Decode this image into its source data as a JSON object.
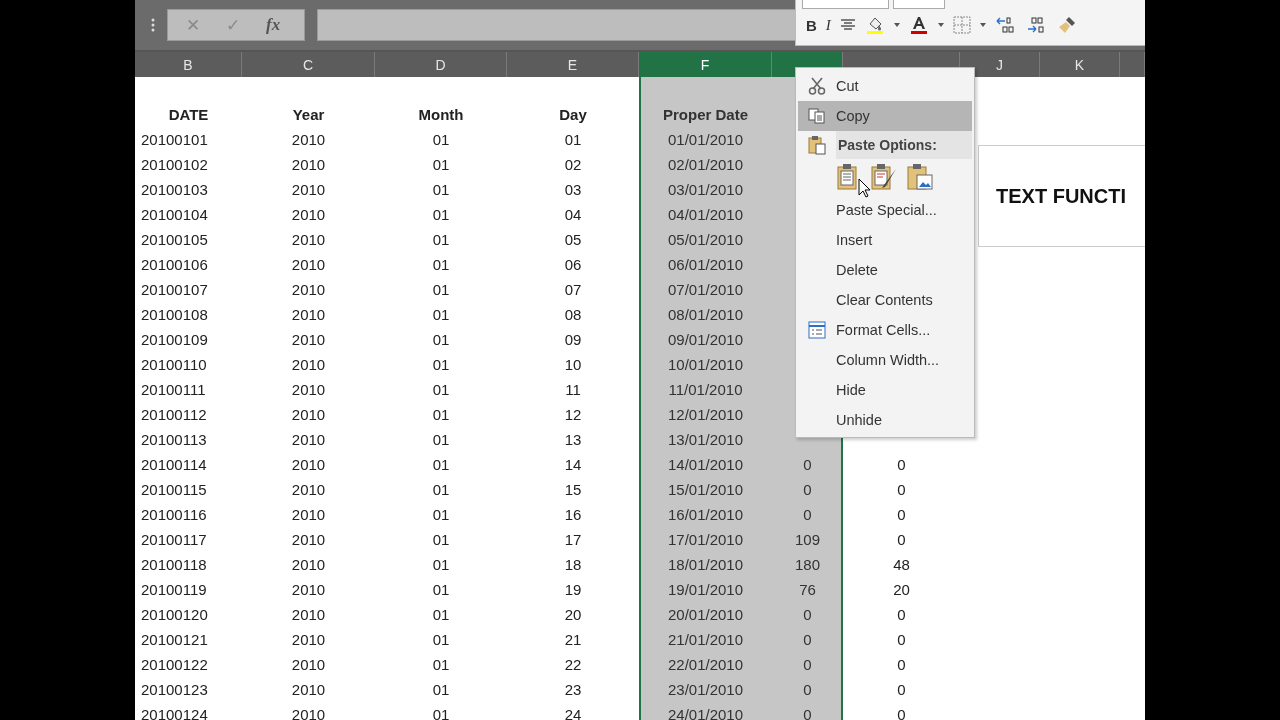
{
  "formula_bar": {
    "cancel": "✕",
    "enter": "✓",
    "function": "fx"
  },
  "columns": [
    {
      "label": "B",
      "selected": false
    },
    {
      "label": "C",
      "selected": false
    },
    {
      "label": "D",
      "selected": false
    },
    {
      "label": "E",
      "selected": false
    },
    {
      "label": "F",
      "selected": true
    },
    {
      "selected": true
    },
    {
      "selected": false
    },
    {
      "label": "J",
      "selected": false
    },
    {
      "label": "K",
      "selected": false
    }
  ],
  "headers": [
    "DATE",
    "Year",
    "Month",
    "Day",
    "Proper Date"
  ],
  "rows": [
    {
      "date": "20100101",
      "year": "2010",
      "month": "01",
      "day": "01",
      "proper_date": "01/01/2010"
    },
    {
      "date": "20100102",
      "year": "2010",
      "month": "01",
      "day": "02",
      "proper_date": "02/01/2010"
    },
    {
      "date": "20100103",
      "year": "2010",
      "month": "01",
      "day": "03",
      "proper_date": "03/01/2010"
    },
    {
      "date": "20100104",
      "year": "2010",
      "month": "01",
      "day": "04",
      "proper_date": "04/01/2010"
    },
    {
      "date": "20100105",
      "year": "2010",
      "month": "01",
      "day": "05",
      "proper_date": "05/01/2010"
    },
    {
      "date": "20100106",
      "year": "2010",
      "month": "01",
      "day": "06",
      "proper_date": "06/01/2010"
    },
    {
      "date": "20100107",
      "year": "2010",
      "month": "01",
      "day": "07",
      "proper_date": "07/01/2010"
    },
    {
      "date": "20100108",
      "year": "2010",
      "month": "01",
      "day": "08",
      "proper_date": "08/01/2010"
    },
    {
      "date": "20100109",
      "year": "2010",
      "month": "01",
      "day": "09",
      "proper_date": "09/01/2010"
    },
    {
      "date": "20100110",
      "year": "2010",
      "month": "01",
      "day": "10",
      "proper_date": "10/01/2010"
    },
    {
      "date": "20100111",
      "year": "2010",
      "month": "01",
      "day": "11",
      "proper_date": "11/01/2010"
    },
    {
      "date": "20100112",
      "year": "2010",
      "month": "01",
      "day": "12",
      "proper_date": "12/01/2010"
    },
    {
      "date": "20100113",
      "year": "2010",
      "month": "01",
      "day": "13",
      "proper_date": "13/01/2010"
    },
    {
      "date": "20100114",
      "year": "2010",
      "month": "01",
      "day": "14",
      "proper_date": "14/01/2010",
      "col_h": "0",
      "col_i": "0"
    },
    {
      "date": "20100115",
      "year": "2010",
      "month": "01",
      "day": "15",
      "proper_date": "15/01/2010",
      "col_h": "0",
      "col_i": "0"
    },
    {
      "date": "20100116",
      "year": "2010",
      "month": "01",
      "day": "16",
      "proper_date": "16/01/2010",
      "col_h": "0",
      "col_i": "0"
    },
    {
      "date": "20100117",
      "year": "2010",
      "month": "01",
      "day": "17",
      "proper_date": "17/01/2010",
      "col_h": "109",
      "col_i": "0"
    },
    {
      "date": "20100118",
      "year": "2010",
      "month": "01",
      "day": "18",
      "proper_date": "18/01/2010",
      "col_h": "180",
      "col_i": "48"
    },
    {
      "date": "20100119",
      "year": "2010",
      "month": "01",
      "day": "19",
      "proper_date": "19/01/2010",
      "col_h": "76",
      "col_i": "20"
    },
    {
      "date": "20100120",
      "year": "2010",
      "month": "01",
      "day": "20",
      "proper_date": "20/01/2010",
      "col_h": "0",
      "col_i": "0"
    },
    {
      "date": "20100121",
      "year": "2010",
      "month": "01",
      "day": "21",
      "proper_date": "21/01/2010",
      "col_h": "0",
      "col_i": "0"
    },
    {
      "date": "20100122",
      "year": "2010",
      "month": "01",
      "day": "22",
      "proper_date": "22/01/2010",
      "col_h": "0",
      "col_i": "0"
    },
    {
      "date": "20100123",
      "year": "2010",
      "month": "01",
      "day": "23",
      "proper_date": "23/01/2010",
      "col_h": "0",
      "col_i": "0"
    },
    {
      "date": "20100124",
      "year": "2010",
      "month": "01",
      "day": "24",
      "proper_date": "24/01/2010",
      "col_h": "0",
      "col_i": "0"
    }
  ],
  "mini_toolbar": {
    "bold": "B",
    "italic": "I"
  },
  "context_menu": {
    "items": [
      {
        "kind": "command",
        "label": "Cut",
        "selected": false
      },
      {
        "kind": "command",
        "label": "Copy",
        "selected": true
      },
      {
        "kind": "header",
        "label": "Paste Options:"
      },
      {
        "kind": "paste-icons"
      },
      {
        "kind": "command",
        "label": "Paste Special...",
        "selected": false
      },
      {
        "kind": "command",
        "label": "Insert",
        "selected": false
      },
      {
        "kind": "command",
        "label": "Delete",
        "selected": false
      },
      {
        "kind": "command",
        "label": "Clear Contents",
        "selected": false
      },
      {
        "kind": "command",
        "label": "Format Cells...",
        "selected": false
      },
      {
        "kind": "command",
        "label": "Column Width...",
        "selected": false
      },
      {
        "kind": "command",
        "label": "Hide",
        "selected": false
      },
      {
        "kind": "command",
        "label": "Unhide",
        "selected": false
      }
    ]
  },
  "text_box": {
    "text": "TEXT FUNCTI"
  }
}
